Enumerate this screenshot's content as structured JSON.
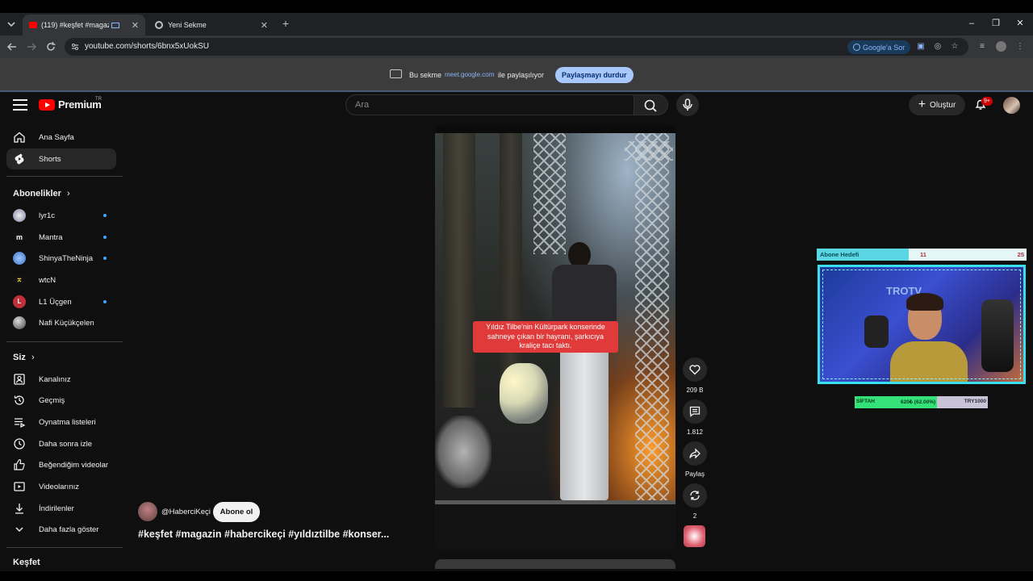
{
  "browser": {
    "tabs": [
      {
        "title": "(119) #keşfet #magazin #h",
        "active": true
      },
      {
        "title": "Yeni Sekme",
        "active": false
      }
    ],
    "url": "youtube.com/shorts/6bnx5xUokSU",
    "google_ask_label": "Google'a Sor",
    "share_bar": {
      "text_before": "Bu sekme",
      "domain": "meet.google.com",
      "text_after": "ile paylaşılıyor",
      "stop_button": "Paylaşmayı durdur"
    }
  },
  "header": {
    "logo_text": "Premium",
    "region": "TR",
    "search_placeholder": "Ara",
    "create_label": "Oluştur",
    "notification_badge": "9+"
  },
  "sidebar": {
    "main": [
      {
        "label": "Ana Sayfa",
        "icon": "home-icon"
      },
      {
        "label": "Shorts",
        "icon": "shorts-icon",
        "active": true
      }
    ],
    "subscriptions_heading": "Abonelikler",
    "subscriptions": [
      {
        "label": "lyr1c",
        "new": true
      },
      {
        "label": "Mantra",
        "new": true
      },
      {
        "label": "ShinyaTheNinja",
        "new": true
      },
      {
        "label": "wtcN",
        "new": false
      },
      {
        "label": "L1 Üçgen",
        "new": true
      },
      {
        "label": "Nafi Küçükçelen",
        "new": false
      }
    ],
    "you_heading": "Siz",
    "you": [
      {
        "label": "Kanalınız",
        "icon": "channel-icon"
      },
      {
        "label": "Geçmiş",
        "icon": "history-icon"
      },
      {
        "label": "Oynatma listeleri",
        "icon": "playlist-icon"
      },
      {
        "label": "Daha sonra izle",
        "icon": "clock-icon"
      },
      {
        "label": "Beğendiğim videolar",
        "icon": "thumbs-up-icon"
      },
      {
        "label": "Videolarınız",
        "icon": "video-icon"
      },
      {
        "label": "İndirilenler",
        "icon": "download-icon"
      },
      {
        "label": "Daha fazla göster",
        "icon": "chevron-down-icon"
      }
    ],
    "explore_heading": "Keşfet"
  },
  "short": {
    "caption": "Yıldız Tilbe'nin Kültürpark konserinde sahneye çıkan bir hayranı, şarkıcıya kraliçe tacı taktı.",
    "channel": "@HaberciKeçi",
    "subscribe_label": "Abone ol",
    "title": "#keşfet #magazin #habercikeçi #yıldıztilbe #konser...",
    "actions": {
      "likes": "209 B",
      "comments": "1.812",
      "share": "Paylaş",
      "remix": "2"
    }
  },
  "overlay": {
    "goal_label": "Abone Hedefi",
    "goal_current": "11",
    "goal_target": "25",
    "goal_progress": 0.44,
    "webcam_sign": "TROTV",
    "siftah_label": "SİFTAH",
    "siftah_progress": "620₺ (62.00%)",
    "siftah_target": "TRY1000"
  },
  "colors": {
    "background": "#0f0f0f",
    "yt_red": "#ff0000",
    "accent_blue": "#3ea6ff",
    "caption_red": "#e03a3a",
    "overlay_cyan": "#38e0ee",
    "siftah_green": "#35e27a"
  }
}
